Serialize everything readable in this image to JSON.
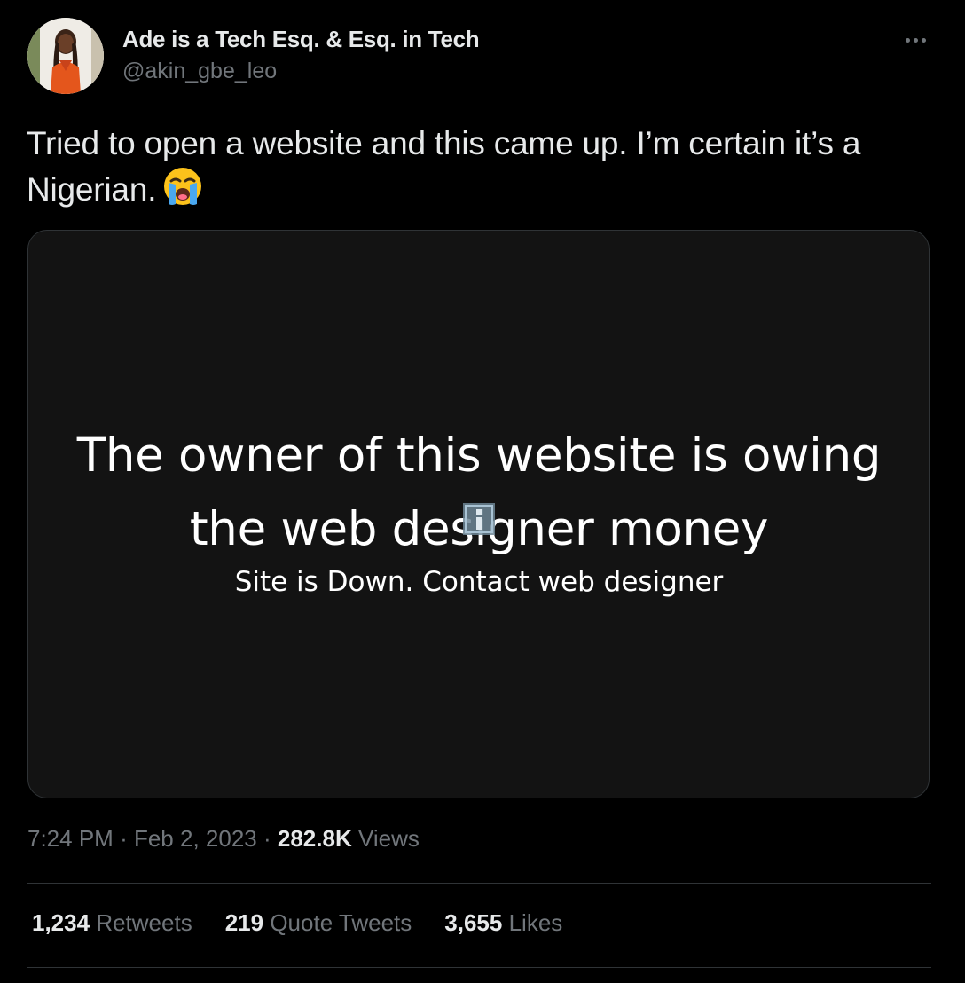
{
  "tweet": {
    "author": {
      "display_name": "Ade is a Tech Esq. & Esq. in Tech",
      "handle": "@akin_gbe_leo",
      "avatar_icon": "profile-avatar"
    },
    "more_icon": "more-horizontal-icon",
    "text": "Tried to open a website and this came up. I’m certain it’s a Nigerian.",
    "emoji": "loudly-crying-face",
    "media": {
      "headline_line1": "The owner of this website is owing",
      "headline_line2": "the web designer money",
      "subtext": "Site is Down. Contact web designer",
      "overlay_icon": "broken-image-icon"
    },
    "meta": {
      "time": "7:24 PM",
      "separator": "·",
      "date": "Feb 2, 2023",
      "views_count": "282.8K",
      "views_label": "Views"
    },
    "stats": {
      "retweets_count": "1,234",
      "retweets_label": "Retweets",
      "quotes_count": "219",
      "quotes_label": "Quote Tweets",
      "likes_count": "3,655",
      "likes_label": "Likes"
    }
  },
  "colors": {
    "background": "#000000",
    "primary_text": "#e7e9ea",
    "secondary_text": "#71767b",
    "divider": "#2f3336",
    "media_background": "#131313"
  }
}
